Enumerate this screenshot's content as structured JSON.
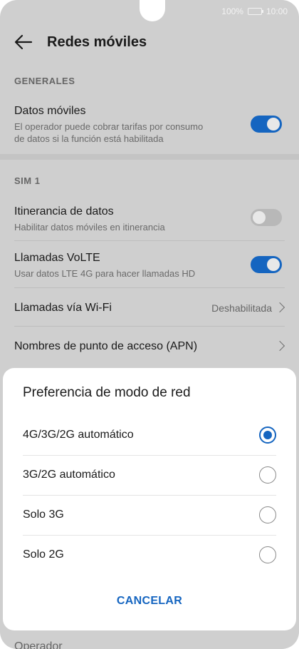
{
  "status_bar": {
    "battery_percent": "100%",
    "time": "10:00"
  },
  "header": {
    "title": "Redes móviles"
  },
  "sections": {
    "general": {
      "label": "GENERALES"
    },
    "sim1": {
      "label": "SIM 1"
    }
  },
  "settings": {
    "mobile_data": {
      "title": "Datos móviles",
      "subtitle_line1": "El operador puede cobrar tarifas por consumo",
      "subtitle_line2": "de datos si la función está habilitada",
      "enabled": true
    },
    "data_roaming": {
      "title": "Itinerancia de datos",
      "subtitle": "Habilitar datos móviles en itinerancia",
      "enabled": false
    },
    "volte": {
      "title": "Llamadas VoLTE",
      "subtitle": "Usar datos LTE 4G para hacer llamadas HD",
      "enabled": true
    },
    "wifi_calling": {
      "title": "Llamadas vía Wi-Fi",
      "value": "Deshabilitada"
    },
    "apn": {
      "title": "Nombres de punto de acceso (APN)"
    },
    "operator_partial": "Operador"
  },
  "dialog": {
    "title": "Preferencia de modo de red",
    "options": [
      {
        "label": "4G/3G/2G automático",
        "selected": true
      },
      {
        "label": "3G/2G automático",
        "selected": false
      },
      {
        "label": "Solo 3G",
        "selected": false
      },
      {
        "label": "Solo 2G",
        "selected": false
      }
    ],
    "cancel_label": "CANCELAR"
  },
  "colors": {
    "accent": "#1565c0",
    "overlay_bg": "#cfcfcf",
    "dialog_bg": "#ffffff"
  }
}
